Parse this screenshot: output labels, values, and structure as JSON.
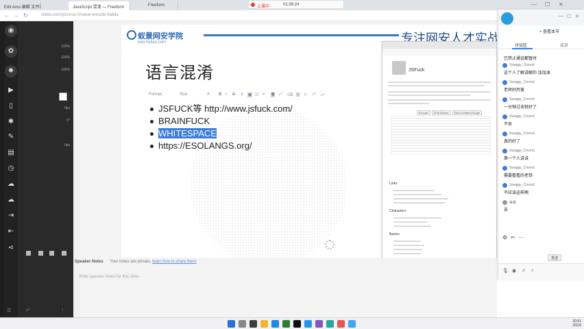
{
  "browser": {
    "tabs": [
      "Edit Amo 编辑 文件编辑",
      "JavaScript 混淆 — Freeform",
      "Freeform"
    ],
    "url": "slides.com/yos/noo-0/value-encode-0a6da",
    "recording": {
      "label": "上课中",
      "time": "01:39:24"
    }
  },
  "sidebar": {
    "settings": [
      {
        "label": "",
        "value": ""
      },
      {
        "label": "",
        "value": "100%"
      },
      {
        "label": "",
        "value": "100%"
      },
      {
        "label": "",
        "value": "100%"
      },
      {
        "label": "",
        "value": ""
      },
      {
        "label": "",
        "value": "0px"
      },
      {
        "label": "",
        "value": "0°"
      },
      {
        "label": "",
        "value": "0px"
      }
    ],
    "icons": [
      "grid-icon",
      "palette-icon",
      "cog-icon",
      "play-icon",
      "bookmark-icon",
      "settings-icon",
      "pencil-icon",
      "layers-icon",
      "history-icon",
      "cloud-upload-icon",
      "cloud-icon",
      "export-icon",
      "import-icon",
      "share-icon"
    ]
  },
  "slide": {
    "logo_cn": "蚁景网安学院",
    "logo_en": "edu.hetian.com",
    "slogan": "专注网安人才实战培",
    "title": "语言混淆",
    "format_bar": {
      "format": "Format",
      "size": "Size",
      "buttons": [
        "A",
        "B",
        "I",
        "S",
        "≡",
        "≣",
        "☷",
        "❝",
        "⧉",
        "⤢",
        "⌫",
        "⛓",
        "⚐",
        "⤺",
        "⤻"
      ]
    },
    "bullets": [
      "JSFUCK等 http://www.jsfuck.com/",
      "BRAINFUCK",
      "WHITESPACE",
      "https://ESOLANGS.org/"
    ],
    "embed": {
      "title": "JSFuck",
      "buttons": [
        "Encode",
        "Eval Source",
        "Run In Parent Scope"
      ],
      "headings": [
        "Links",
        "Characters",
        "Basics"
      ]
    }
  },
  "notes": {
    "label": "Speaker Notes",
    "text": "Your notes are private,",
    "link": "learn how to share them",
    "placeholder": "Write speaker notes for this slide."
  },
  "chat": {
    "sub": "+ 查看本节",
    "tabs": [
      "讨论区",
      "成员"
    ],
    "messages": [
      {
        "name": "",
        "text": "已禁止通话都暂时"
      },
      {
        "name": "Swaggy_Cmnnd",
        "text": "这个人了解讲解的 加加油"
      },
      {
        "name": "Swaggy_Cmnnd",
        "text": "老师好厉害"
      },
      {
        "name": "Swaggy_Cmnnd",
        "text": "一分钟过去就好了"
      },
      {
        "name": "Swaggy_Cmnnd",
        "text": "不良"
      },
      {
        "name": "Swaggy_Cmnnd",
        "text": "真的好了"
      },
      {
        "name": "Swaggy_Cmnnd",
        "text": "第一个人讲讲"
      },
      {
        "name": "Swaggy_Cmnnd",
        "text": "需要看看的老铁"
      },
      {
        "name": "Swaggy_Cmnnd",
        "text": "不应该这样啊"
      },
      {
        "name": "等量",
        "text": "吾"
      }
    ],
    "send": "发送"
  },
  "taskbar": {
    "clock_time": "20:51",
    "clock_date": "2023/"
  }
}
